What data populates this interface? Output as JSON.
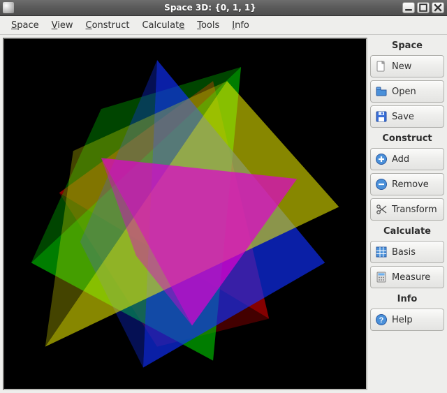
{
  "window": {
    "title": "Space 3D: {0, 1, 1}"
  },
  "menu": {
    "items": [
      {
        "label": "Space",
        "accel_index": 0
      },
      {
        "label": "View",
        "accel_index": 0
      },
      {
        "label": "Construct",
        "accel_index": 0
      },
      {
        "label": "Calculate",
        "accel_index": 8
      },
      {
        "label": "Tools",
        "accel_index": 0
      },
      {
        "label": "Info",
        "accel_index": 0
      }
    ]
  },
  "panel": {
    "sections": [
      {
        "title": "Space",
        "buttons": [
          {
            "id": "new",
            "label": "New",
            "icon": "file-new-icon"
          },
          {
            "id": "open",
            "label": "Open",
            "icon": "folder-open-icon"
          },
          {
            "id": "save",
            "label": "Save",
            "icon": "floppy-save-icon"
          }
        ]
      },
      {
        "title": "Construct",
        "buttons": [
          {
            "id": "add",
            "label": "Add",
            "icon": "plus-circle-icon"
          },
          {
            "id": "remove",
            "label": "Remove",
            "icon": "minus-circle-icon"
          },
          {
            "id": "transform",
            "label": "Transform",
            "icon": "scissors-icon"
          }
        ]
      },
      {
        "title": "Calculate",
        "buttons": [
          {
            "id": "basis",
            "label": "Basis",
            "icon": "grid-icon"
          },
          {
            "id": "measure",
            "label": "Measure",
            "icon": "calculator-icon"
          }
        ]
      },
      {
        "title": "Info",
        "buttons": [
          {
            "id": "help",
            "label": "Help",
            "icon": "help-circle-icon"
          }
        ]
      }
    ]
  },
  "viewport": {
    "background": "#000000",
    "shapes": [
      {
        "color": "#cc0000",
        "opacity": 0.65
      },
      {
        "color": "#00c000",
        "opacity": 0.65
      },
      {
        "color": "#1030ff",
        "opacity": 0.65
      },
      {
        "color": "#f5f500",
        "opacity": 0.55
      },
      {
        "color": "#e000d0",
        "opacity": 0.7
      }
    ]
  }
}
